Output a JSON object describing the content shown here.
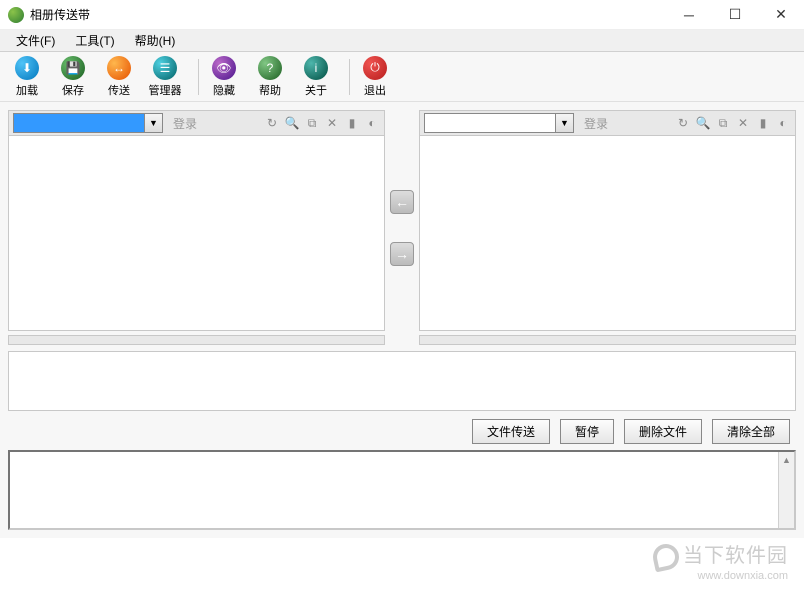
{
  "window": {
    "title": "相册传送带"
  },
  "menu": {
    "file": "文件(F)",
    "tools": "工具(T)",
    "help": "帮助(H)"
  },
  "toolbar": {
    "load": "加载",
    "save": "保存",
    "transfer": "传送",
    "manager": "管理器",
    "hide": "隐藏",
    "help": "帮助",
    "about": "关于",
    "exit": "退出"
  },
  "panel": {
    "login": "登录"
  },
  "buttons": {
    "file_transfer": "文件传送",
    "pause": "暂停",
    "delete_file": "删除文件",
    "clear_all": "清除全部"
  },
  "watermark": {
    "text": "当下软件园",
    "url": "www.downxia.com"
  }
}
